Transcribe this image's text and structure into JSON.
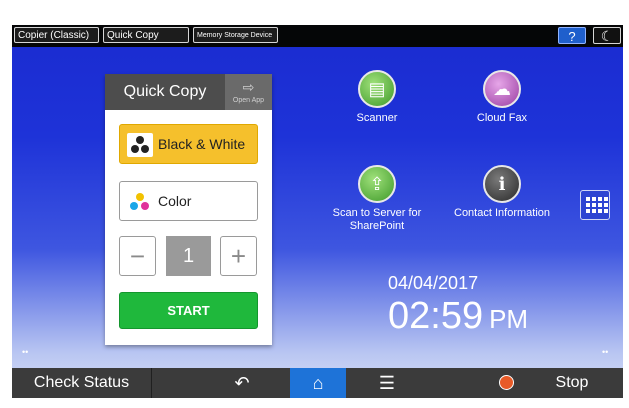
{
  "top_tabs": [
    {
      "label": "Copier (Classic)"
    },
    {
      "label": "Quick Copy"
    },
    {
      "label": "Memory Storage Device"
    }
  ],
  "top_buttons": {
    "help": "?",
    "night_mode": "☾"
  },
  "quick_copy": {
    "title": "Quick Copy",
    "open_app": "Open App",
    "black_white": "Black & White",
    "color": "Color",
    "minus": "−",
    "quantity": "1",
    "plus": "+",
    "start": "START"
  },
  "apps": [
    {
      "label": "Scanner",
      "icon": "scanner-icon"
    },
    {
      "label": "Cloud Fax",
      "icon": "cloud-fax-icon"
    },
    {
      "label": "Scan to Server for SharePoint",
      "icon": "sharepoint-icon"
    },
    {
      "label": "Contact Information",
      "icon": "contact-icon"
    }
  ],
  "clock": {
    "date": "04/04/2017",
    "time": "02:59",
    "ampm": "PM"
  },
  "bottom_bar": {
    "check_status": "Check Status",
    "back": "↶",
    "home": "⌂",
    "menu": "☰",
    "stop": "Stop"
  },
  "colors": {
    "accent": "#1e73d8",
    "start": "#1fb83c",
    "bw_button": "#f5c02c",
    "stop_icon": "#e85a27"
  }
}
